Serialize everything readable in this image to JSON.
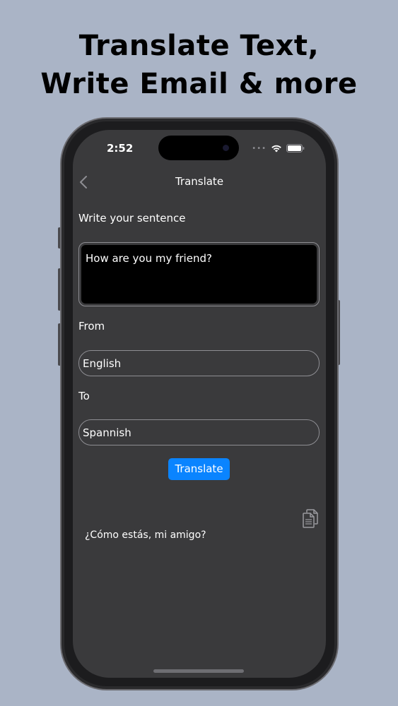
{
  "headline": {
    "line1": "Translate Text,",
    "line2": "Write Email & more"
  },
  "status_bar": {
    "time": "2:52",
    "dots": "•••"
  },
  "nav": {
    "title": "Translate"
  },
  "form": {
    "sentence_label": "Write your sentence",
    "sentence_value": "How are you my friend?",
    "from_label": "From",
    "from_value": "English",
    "to_label": "To",
    "to_value": "Spannish",
    "translate_button": "Translate"
  },
  "result": {
    "text": "¿Cómo estás, mi amigo?"
  },
  "colors": {
    "background": "#aab4c6",
    "screen": "#3a3a3c",
    "accent": "#0a84ff"
  }
}
